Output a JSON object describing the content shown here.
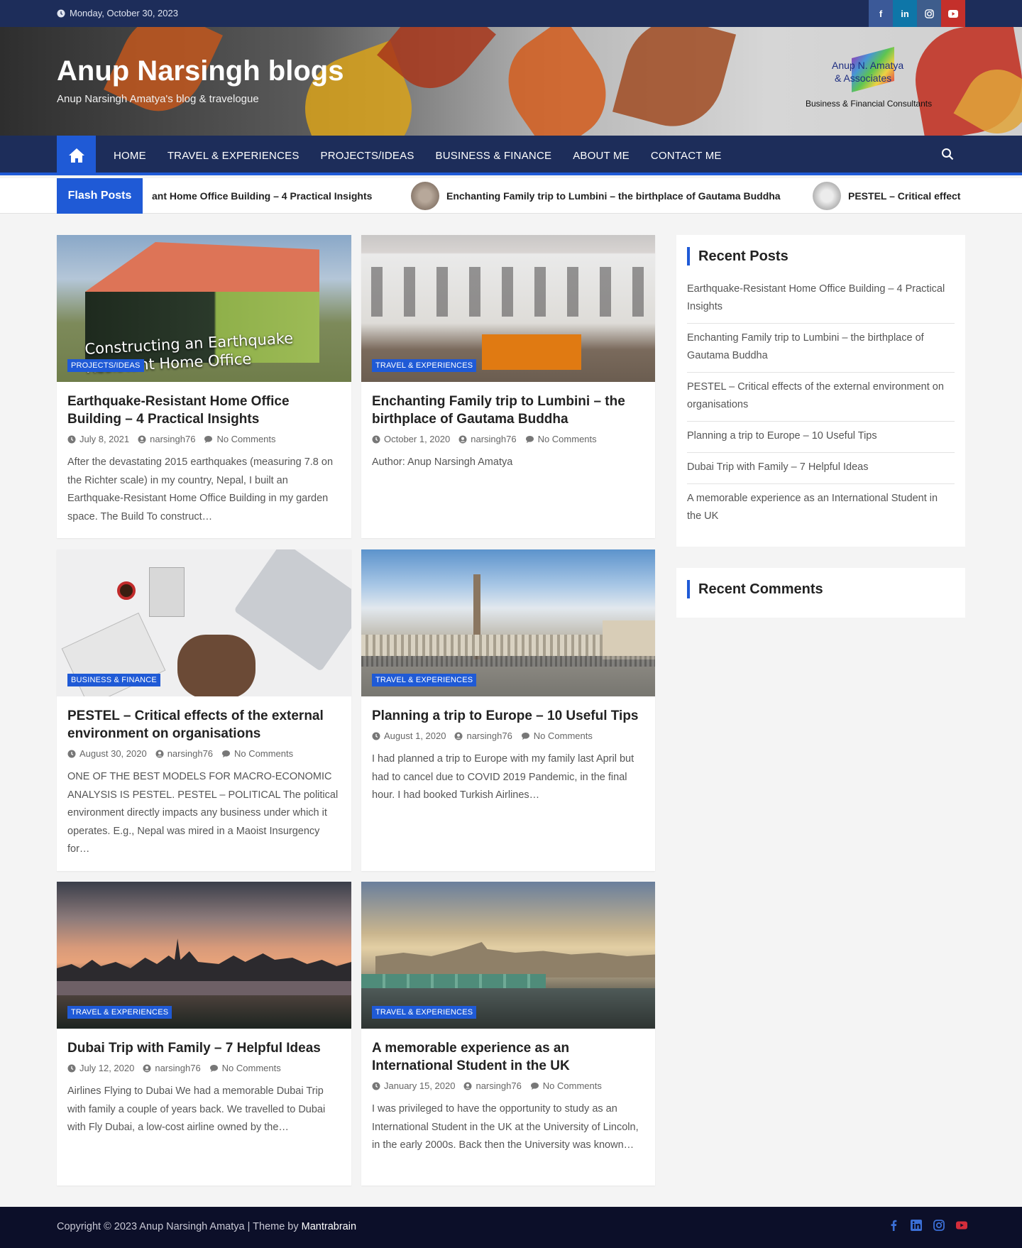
{
  "topbar": {
    "date": "Monday, October 30, 2023",
    "social": [
      "facebook-icon",
      "linkedin-icon",
      "instagram-icon",
      "youtube-icon"
    ]
  },
  "header": {
    "title": "Anup Narsingh blogs",
    "tagline": "Anup Narsingh Amatya's blog & travelogue",
    "logo_line1": "Anup N. Amatya",
    "logo_line2": "& Associates",
    "logo_line3": "Business & Financial Consultants"
  },
  "nav": {
    "items": [
      "HOME",
      "TRAVEL & EXPERIENCES",
      "PROJECTS/IDEAS",
      "BUSINESS & FINANCE",
      "ABOUT ME",
      "CONTACT ME"
    ]
  },
  "flash": {
    "label": "Flash Posts",
    "items": [
      "ant Home Office Building – 4 Practical Insights",
      "Enchanting Family trip to Lumbini – the birthplace of Gautama Buddha",
      "PESTEL – Critical effect"
    ]
  },
  "posts": [
    {
      "category": "PROJECTS/IDEAS",
      "title": "Earthquake-Resistant Home Office Building – 4 Practical Insights",
      "date": "July 8, 2021",
      "author": "narsingh76",
      "comments": "No Comments",
      "excerpt": "After the devastating 2015 earthquakes (measuring 7.8 on the Richter scale) in my country, Nepal, I built an Earthquake-Resistant Home Office Building in my garden space. The Build To construct…",
      "image_caption": "Constructing an Earthquake Resistant Home Office"
    },
    {
      "category": "TRAVEL & EXPERIENCES",
      "title": "Enchanting Family trip to Lumbini – the birthplace of Gautama Buddha",
      "date": "October 1, 2020",
      "author": "narsingh76",
      "comments": "No Comments",
      "excerpt": "Author: Anup Narsingh Amatya"
    },
    {
      "category": "BUSINESS & FINANCE",
      "title": "PESTEL – Critical effects of the external environment on organisations",
      "date": "August 30, 2020",
      "author": "narsingh76",
      "comments": "No Comments",
      "excerpt": "ONE OF THE BEST MODELS FOR MACRO-ECONOMIC ANALYSIS IS PESTEL. PESTEL – POLITICAL The political environment directly impacts any business under which it operates. E.g., Nepal was mired in a Maoist Insurgency for…"
    },
    {
      "category": "TRAVEL & EXPERIENCES",
      "title": "Planning a trip to Europe – 10 Useful Tips",
      "date": "August 1, 2020",
      "author": "narsingh76",
      "comments": "No Comments",
      "excerpt": "I had planned a trip to Europe with my family last April but had to cancel due to COVID 2019 Pandemic, in the final hour. I had booked Turkish Airlines…"
    },
    {
      "category": "TRAVEL & EXPERIENCES",
      "title": "Dubai Trip with Family – 7 Helpful Ideas",
      "date": "July 12, 2020",
      "author": "narsingh76",
      "comments": "No Comments",
      "excerpt": "Airlines Flying to Dubai We had a memorable Dubai Trip with family a couple of years back. We travelled to Dubai with Fly Dubai, a low-cost airline owned by the…"
    },
    {
      "category": "TRAVEL & EXPERIENCES",
      "title": "A memorable experience as an International Student in the UK",
      "date": "January 15, 2020",
      "author": "narsingh76",
      "comments": "No Comments",
      "excerpt": "I was privileged to have the opportunity to study as an International Student in the UK at the University of Lincoln, in the early 2000s.  Back then the University was known…"
    }
  ],
  "sidebar": {
    "recent_posts_title": "Recent Posts",
    "recent_posts": [
      "Earthquake-Resistant Home Office Building – 4 Practical Insights",
      "Enchanting Family trip to Lumbini – the birthplace of Gautama Buddha",
      "PESTEL – Critical effects of the external environment on organisations",
      "Planning a trip to Europe – 10 Useful Tips",
      "Dubai Trip with Family – 7 Helpful Ideas",
      "A memorable experience as an International Student in the UK"
    ],
    "recent_comments_title": "Recent Comments"
  },
  "footer": {
    "copyright": "Copyright © 2023 Anup Narsingh Amatya | Theme by ",
    "theme_link": "Mantrabrain",
    "social": [
      "facebook-icon",
      "linkedin-icon",
      "instagram-icon",
      "youtube-icon"
    ]
  },
  "colors": {
    "primary": "#1f5ad6",
    "navy": "#1d2d5a",
    "footer": "#0c0f29"
  }
}
